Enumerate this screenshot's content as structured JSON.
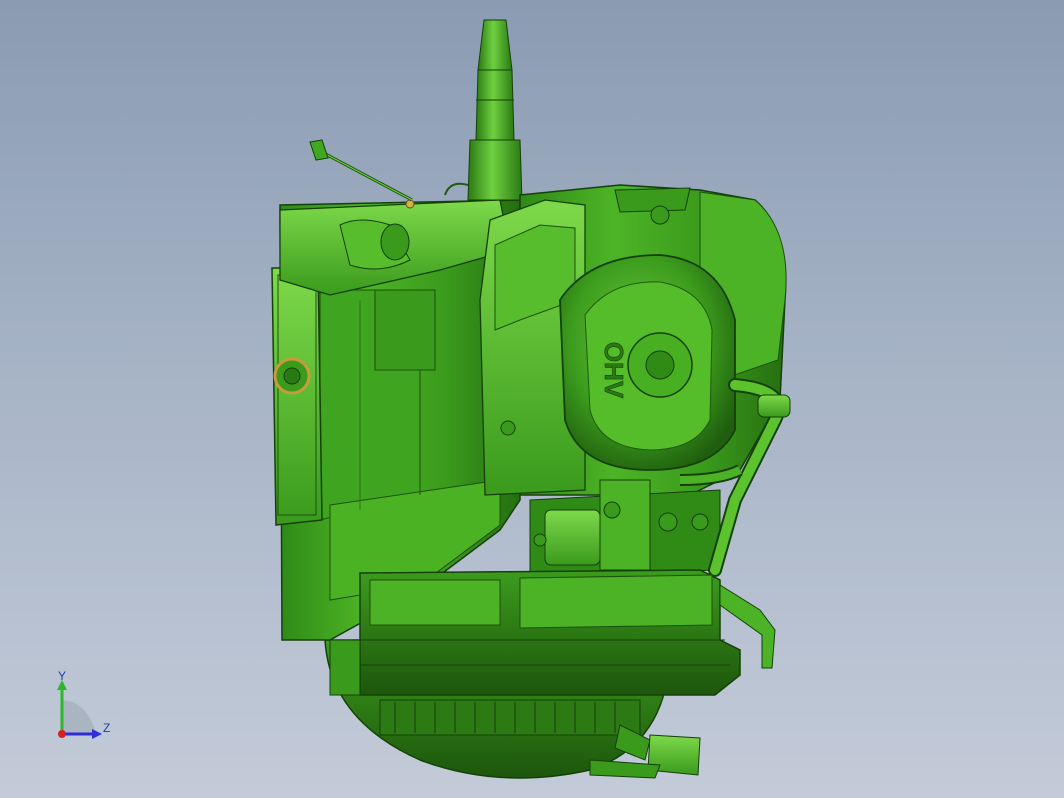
{
  "viewport": {
    "background_top": "#8a9bb2",
    "background_bottom": "#c3cbd8"
  },
  "model": {
    "body_color": "#3fa820",
    "dark_color": "#1f5a10",
    "highlight_color": "#8ee05a",
    "accent_color": "#c89a3a",
    "embossed_text": "OHV"
  },
  "triad": {
    "y_label": "Y",
    "z_label": "Z",
    "y_axis_color": "#2cb82c",
    "z_axis_color": "#2d2ddb",
    "x_axis_color": "#d92020"
  }
}
